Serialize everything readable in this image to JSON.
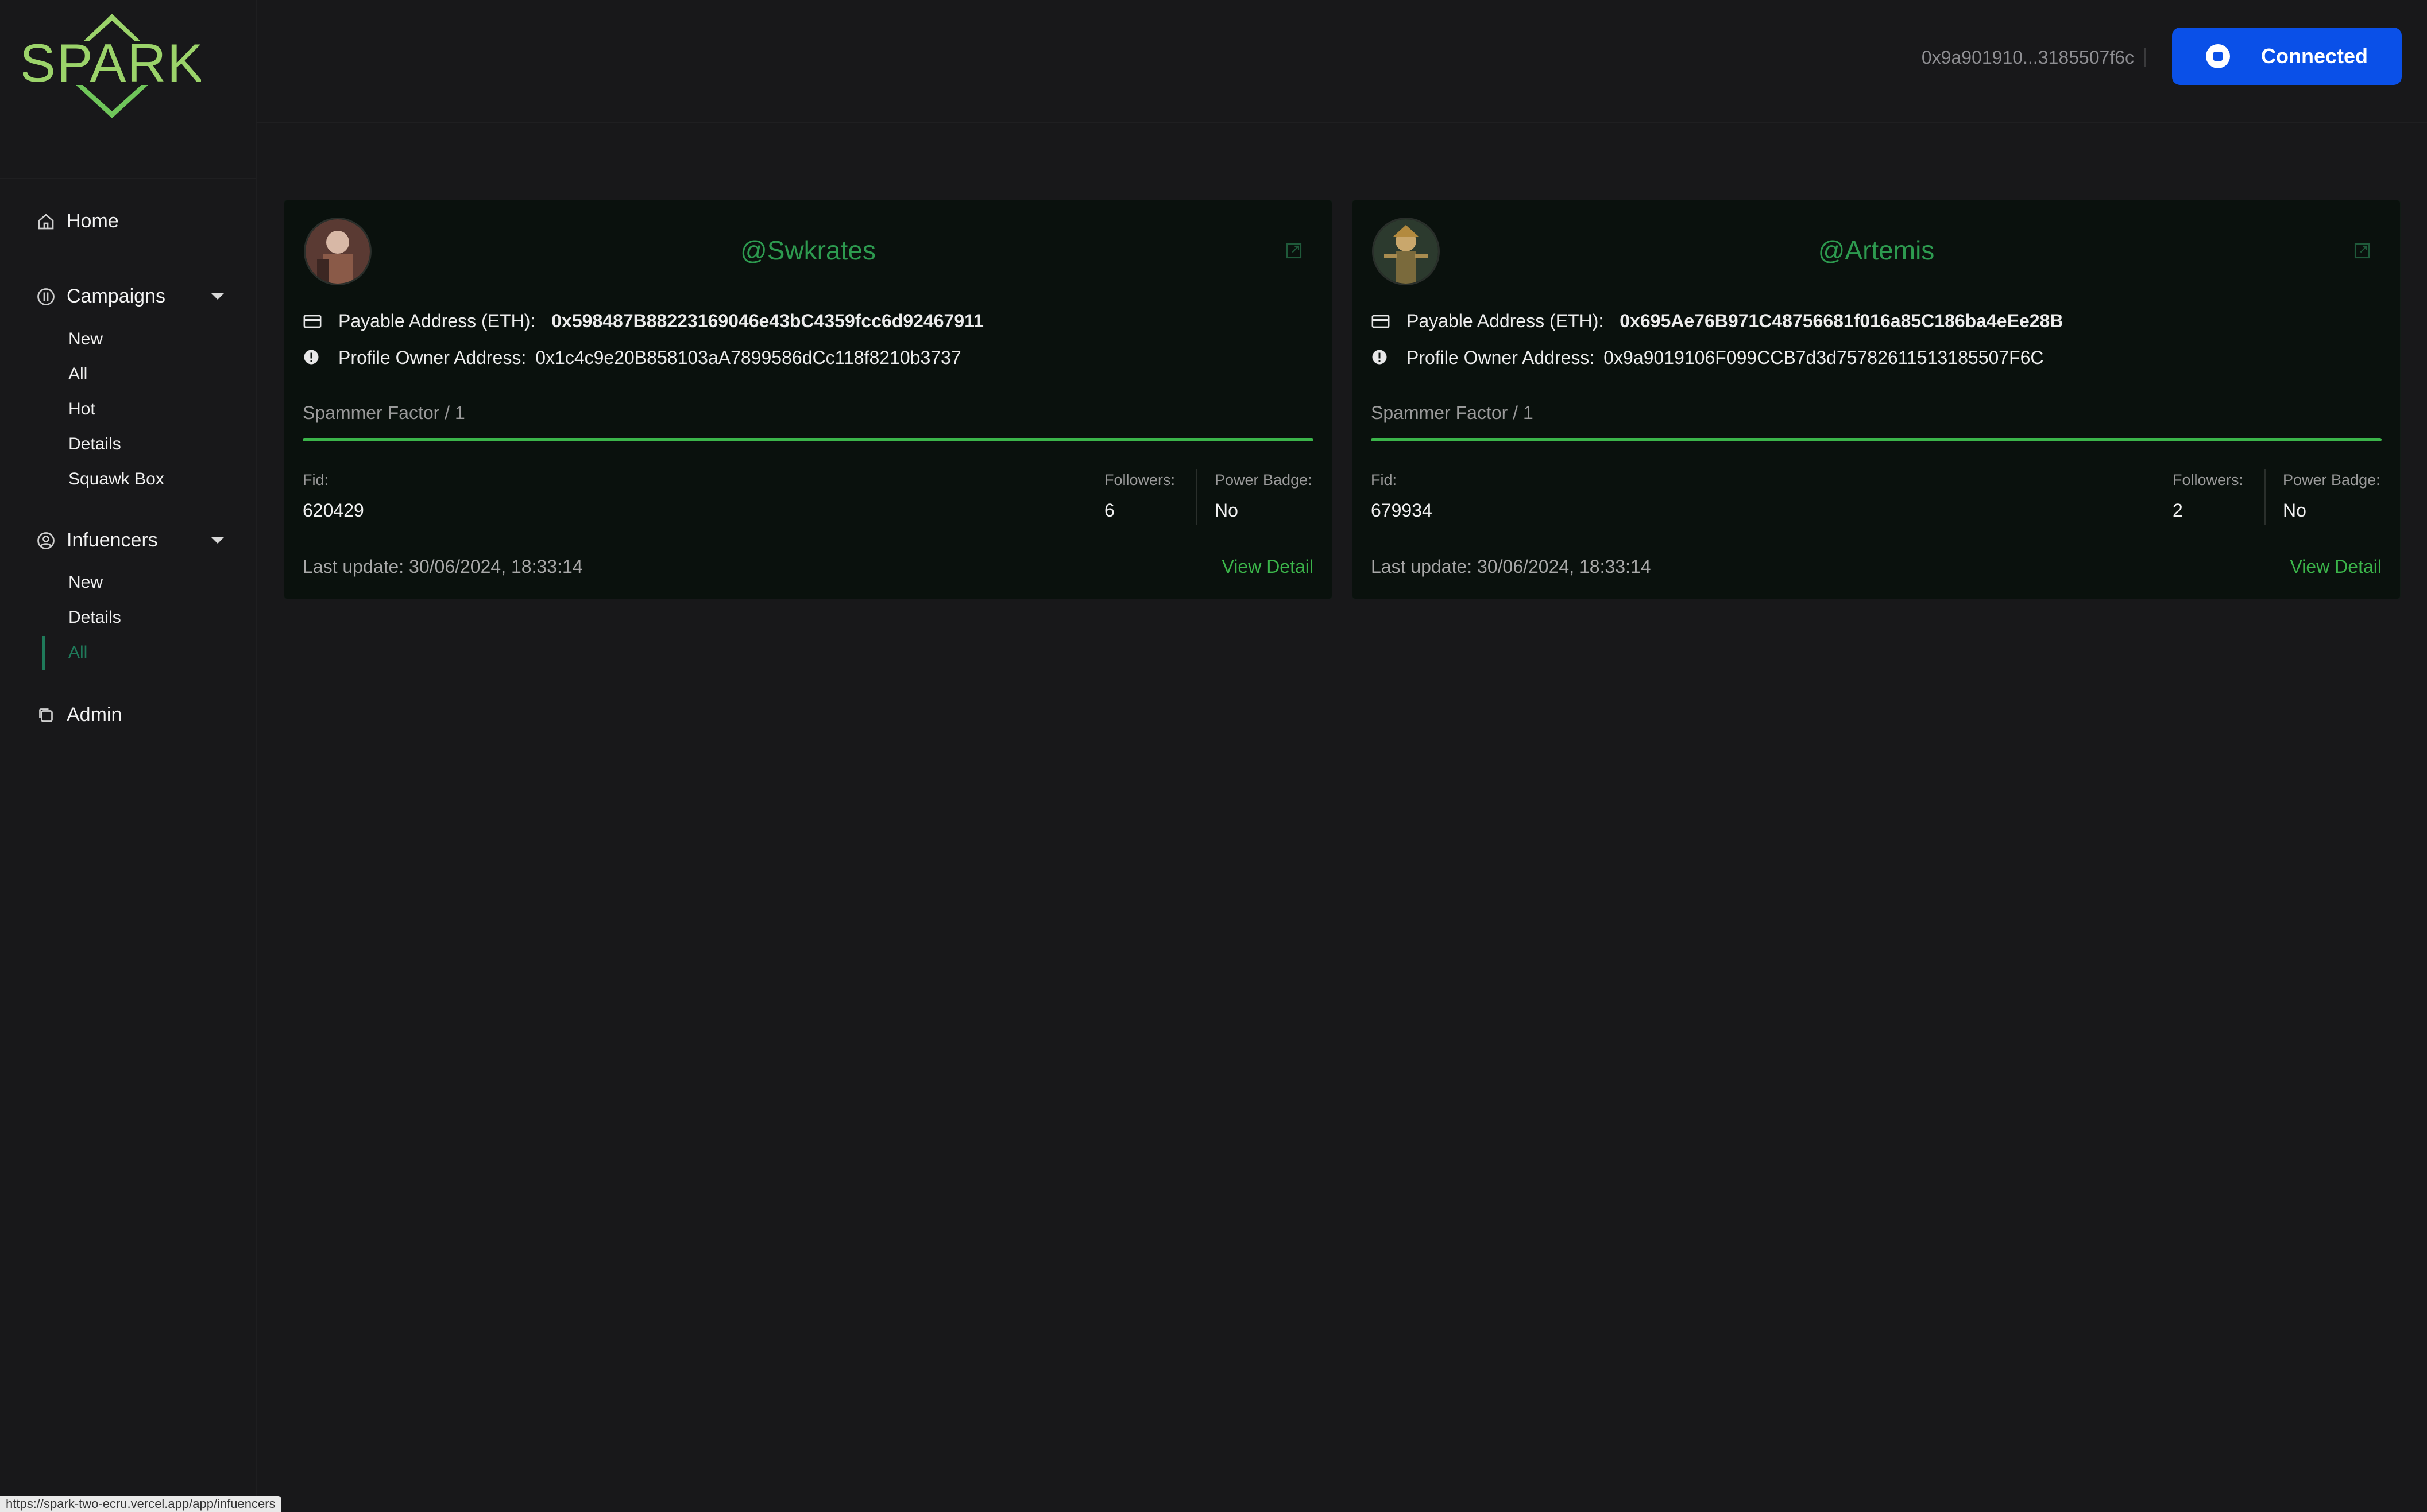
{
  "brand": {
    "logo_text": "SPARK",
    "accent": "#3bb54a",
    "logo_color": "#9bd36a"
  },
  "sidebar": {
    "home": "Home",
    "campaigns": {
      "label": "Campaigns",
      "items": [
        "New",
        "All",
        "Hot",
        "Details",
        "Squawk Box"
      ]
    },
    "influencers": {
      "label": "Infuencers",
      "items": [
        "New",
        "Details",
        "All"
      ],
      "active": "All"
    },
    "admin": "Admin"
  },
  "header": {
    "wallet_address": "0x9a901910...3185507f6c",
    "connect_label": "Connected",
    "connect_color": "#0a50e8"
  },
  "cards": [
    {
      "handle": "@Swkrates",
      "payable_label": "Payable Address (ETH):",
      "payable_address": "0x598487B88223169046e43bC4359fcc6d92467911",
      "owner_label": "Profile Owner Address:",
      "owner_address": "0x1c4c9e20B858103aA7899586dCc118f8210b3737",
      "spam_label": "Spammer Factor / 1",
      "spam_value": 1,
      "fid_label": "Fid:",
      "fid": "620429",
      "followers_label": "Followers:",
      "followers": "6",
      "power_badge_label": "Power Badge:",
      "power_badge": "No",
      "last_update": "Last update: 30/06/2024, 18:33:14",
      "view_detail": "View Detail"
    },
    {
      "handle": "@Artemis",
      "payable_label": "Payable Address (ETH):",
      "payable_address": "0x695Ae76B971C48756681f016a85C186ba4eEe28B",
      "owner_label": "Profile Owner Address:",
      "owner_address": "0x9a9019106F099CCB7d3d75782611513185507F6C",
      "spam_label": "Spammer Factor / 1",
      "spam_value": 1,
      "fid_label": "Fid:",
      "fid": "679934",
      "followers_label": "Followers:",
      "followers": "2",
      "power_badge_label": "Power Badge:",
      "power_badge": "No",
      "last_update": "Last update: 30/06/2024, 18:33:14",
      "view_detail": "View Detail"
    }
  ],
  "status_bar_url": "https://spark-two-ecru.vercel.app/app/infuencers"
}
